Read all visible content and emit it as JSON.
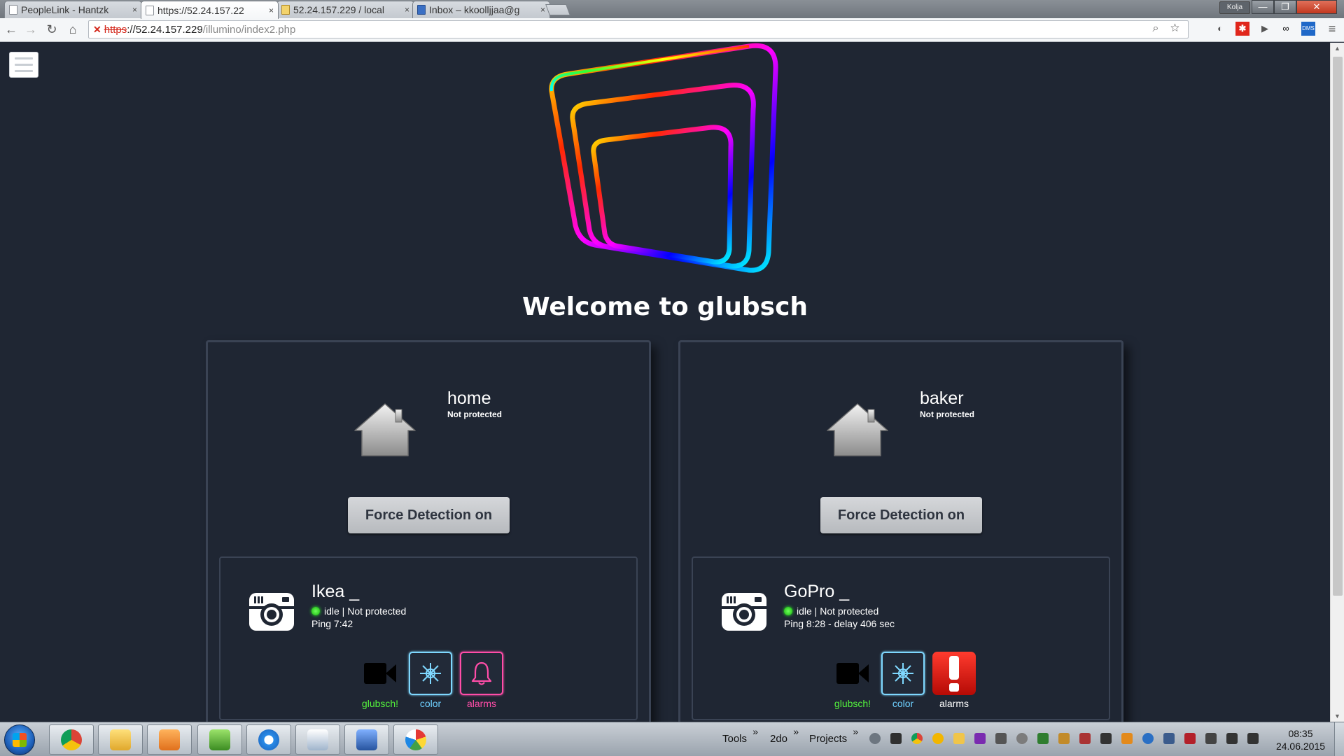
{
  "browser": {
    "tabs": [
      {
        "title": "PeopleLink - Hantzk",
        "active": false,
        "close": "×"
      },
      {
        "title": "https://52.24.157.22",
        "active": true,
        "close": "×"
      },
      {
        "title": "52.24.157.229 / local",
        "active": false,
        "close": "×"
      },
      {
        "title": "Inbox – kkoolljjaa@g",
        "active": false,
        "close": "×"
      }
    ],
    "user_badge": "Kolja",
    "window_buttons": {
      "minimize": "—",
      "maximize": "❐",
      "close": "✕"
    },
    "nav": {
      "back": "←",
      "forward": "→",
      "reload": "↻",
      "home": "⌂"
    },
    "address": {
      "scheme": "https",
      "rest_host": "://52.24.157.229",
      "path": "/illumino/index2.php",
      "lock_error": "✕"
    },
    "omnibox_icons": "⌕ ☆",
    "extensions": [
      "shield-icon",
      "red-extension-icon",
      "play-icon",
      "glasses-icon",
      "dms-icon",
      "menu-icon"
    ],
    "extension_labels": {
      "dms": "DMS",
      "menu": "≡"
    }
  },
  "page": {
    "title": "Welcome to glubsch",
    "locations": [
      {
        "name": "home",
        "status": "Not protected",
        "force_button": "Force Detection on",
        "device": {
          "name": "Ikea _",
          "status": "idle | Not protected",
          "ping": "Ping 7:42",
          "actions": [
            {
              "label": "glubsch!",
              "icon": "video-camera-icon"
            },
            {
              "label": "color",
              "icon": "snowflake-icon"
            },
            {
              "label": "alarms",
              "icon": "bell-icon"
            }
          ]
        }
      },
      {
        "name": "baker",
        "status": "Not protected",
        "force_button": "Force Detection on",
        "device": {
          "name": "GoPro _",
          "status": "idle | Not protected",
          "ping": "Ping 8:28 - delay 406 sec",
          "actions": [
            {
              "label": "glubsch!",
              "icon": "video-camera-icon"
            },
            {
              "label": "color",
              "icon": "snowflake-icon"
            },
            {
              "label": "alarms",
              "icon": "exclamation-alarm-icon"
            }
          ]
        }
      }
    ],
    "colors": {
      "background": "#1f2633",
      "card_border": "#3a4354",
      "status_dot": "#29ff29",
      "glubsch_label": "#53f13c",
      "color_label": "#6ed0ff",
      "alarm_label": "#ff4da8",
      "alarm_active": "#e81710"
    }
  },
  "taskbar": {
    "toolbars": [
      "Tools",
      "2do",
      "Projects"
    ],
    "chevron": "»",
    "clock": {
      "time": "08:35",
      "date": "24.06.2015"
    }
  }
}
